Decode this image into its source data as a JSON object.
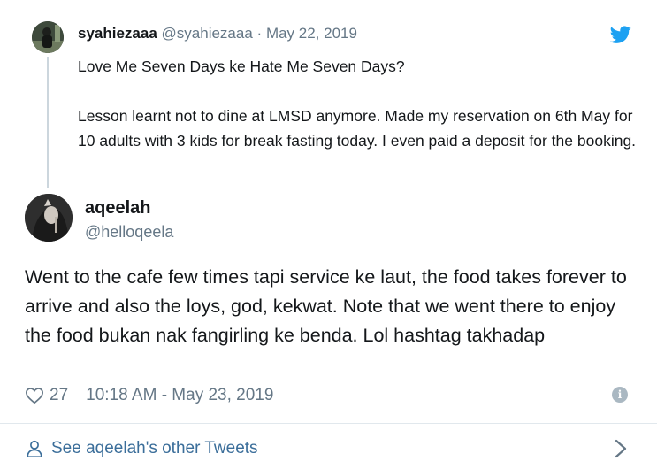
{
  "parent_tweet": {
    "display_name": "syahiezaaa",
    "handle": "@syahiezaaa",
    "separator": "·",
    "date": "May 22, 2019",
    "lines": [
      "Love Me Seven Days ke Hate Me Seven Days?",
      "Lesson learnt not to dine at LMSD anymore. Made my reservation on 6th May for 10 adults with 3 kids for break fasting today. I even paid a deposit for the booking."
    ],
    "logo_icon": "twitter-bird-icon"
  },
  "tweet": {
    "display_name": "aqeelah",
    "handle": "@helloqeela",
    "text": "Went to the cafe few times tapi service ke laut, the food takes forever to arrive and also the loys, god, kekwat. Note that we went there to enjoy the food bukan nak fangirling ke benda. Lol hashtag takhadap",
    "likes": "27",
    "timestamp": "10:18 AM - May 23, 2019",
    "info_icon": "info-icon"
  },
  "footer": {
    "label": "See aqeelah's other Tweets"
  },
  "colors": {
    "twitter_blue": "#1da1f2",
    "muted": "#657786",
    "link": "#3b6e9a"
  }
}
